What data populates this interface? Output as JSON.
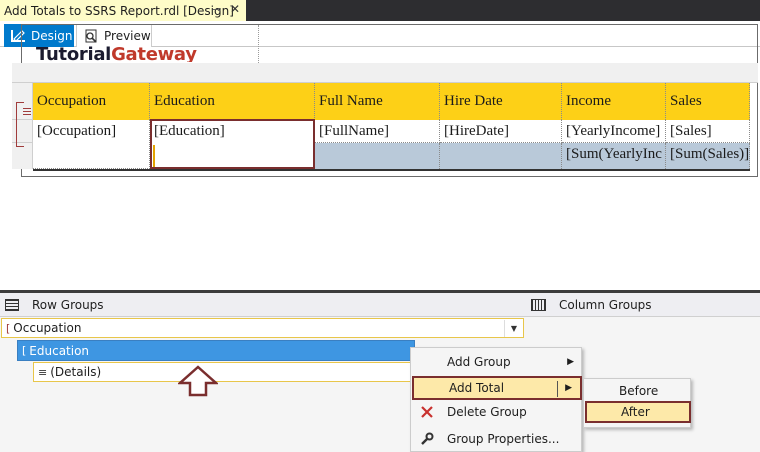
{
  "document_tab": {
    "title": "Add Totals to SSRS Report.rdl [Design]",
    "pin_glyph": "⊸",
    "close_glyph": "✕"
  },
  "view_tabs": {
    "design": "Design",
    "preview": "Preview"
  },
  "report": {
    "logo": {
      "part1": "Tutorial",
      "part2": "Gateway"
    },
    "headers": [
      "Occupation",
      "Education",
      "Full Name",
      "Hire Date",
      "Income",
      "Sales"
    ],
    "data_row": [
      "[Occupation]",
      "[Education]",
      "[FullName]",
      "[HireDate]",
      "[YearlyIncome]",
      "[Sales]"
    ],
    "total_row": [
      "",
      "",
      "",
      "",
      "[Sum(YearlyInc",
      "[Sum(Sales)]"
    ]
  },
  "row_groups": {
    "title": "Row Groups",
    "items": [
      {
        "label": "Occupation",
        "glyph": "["
      },
      {
        "label": "Education",
        "glyph": "["
      },
      {
        "label": "(Details)",
        "glyph": "≡"
      }
    ]
  },
  "column_groups": {
    "title": "Column Groups"
  },
  "context_menu": {
    "items": [
      {
        "label": "Add Group",
        "has_submenu": true
      },
      {
        "label": "Add Total",
        "has_submenu": true,
        "highlighted": true
      },
      {
        "label": "Delete Group",
        "icon": "delete-icon"
      },
      {
        "label": "Group Properties...",
        "icon": "wrench-icon"
      }
    ]
  },
  "submenu": {
    "items": [
      "Before",
      "After"
    ],
    "highlighted": "After"
  },
  "colors": {
    "header_yellow": "#fdd017",
    "total_blue": "#b9c9d9",
    "selection_blue": "#3e96e2",
    "annotation_red": "#7a2e2e",
    "design_tab": "#007acc"
  }
}
